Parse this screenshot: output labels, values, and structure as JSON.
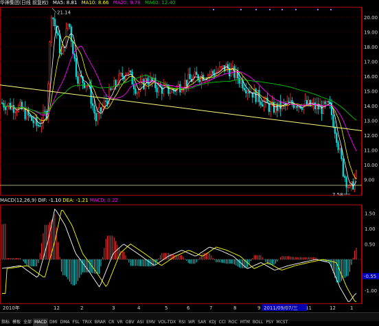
{
  "header": {
    "stock_name": "华神集团(日线 前复权)",
    "ma5": "MA5: 8.81",
    "ma10": "MA10: 8.66",
    "ma20": "MA20: 9.78",
    "ma60": "MA60: 12.40"
  },
  "price_axis": [
    "20.00",
    "19.00",
    "18.00",
    "17.00",
    "16.00",
    "15.00",
    "14.00",
    "13.00",
    "12.00",
    "11.00",
    "10.00",
    "9.00"
  ],
  "annotations": {
    "high": "21.14",
    "low": "7.58"
  },
  "macd_header": {
    "label": "MACD(12,26,9)",
    "dif": "DIF: -1.10",
    "dea": "DEA: -1.21",
    "macd": "MACD: 0.22"
  },
  "macd_axis": [
    "1.50",
    "1.00",
    "0.50",
    "-0.50",
    "-1.00",
    "-1.50"
  ],
  "macd_value_badge": "-0.55",
  "date_labels": [
    "2010年",
    "12",
    "2",
    "3",
    "4",
    "5",
    "6",
    "7",
    "8",
    "9",
    "10",
    "11",
    "12",
    "1"
  ],
  "cursor_date": "2011/09/07/三",
  "tabs": [
    "指标",
    "模板",
    "全部",
    "MACD",
    "DMI",
    "DMA",
    "FSL",
    "TRIX",
    "BRAR",
    "CR",
    "VR",
    "OBV",
    "ASI",
    "EMV",
    "VOL-TDX",
    "RSI",
    "WR",
    "SAR",
    "KDJ",
    "CCI",
    "ROC",
    "MTM",
    "BOLL",
    "PSY",
    "MCST"
  ],
  "colors": {
    "up": "#ff3232",
    "down": "#00e1e1",
    "ma5": "#ffffff",
    "ma10": "#ffff00",
    "ma20": "#ff00ff",
    "ma60": "#00c800",
    "axis_text": "#d8d8d8",
    "panel_border": "#ab0000"
  }
}
